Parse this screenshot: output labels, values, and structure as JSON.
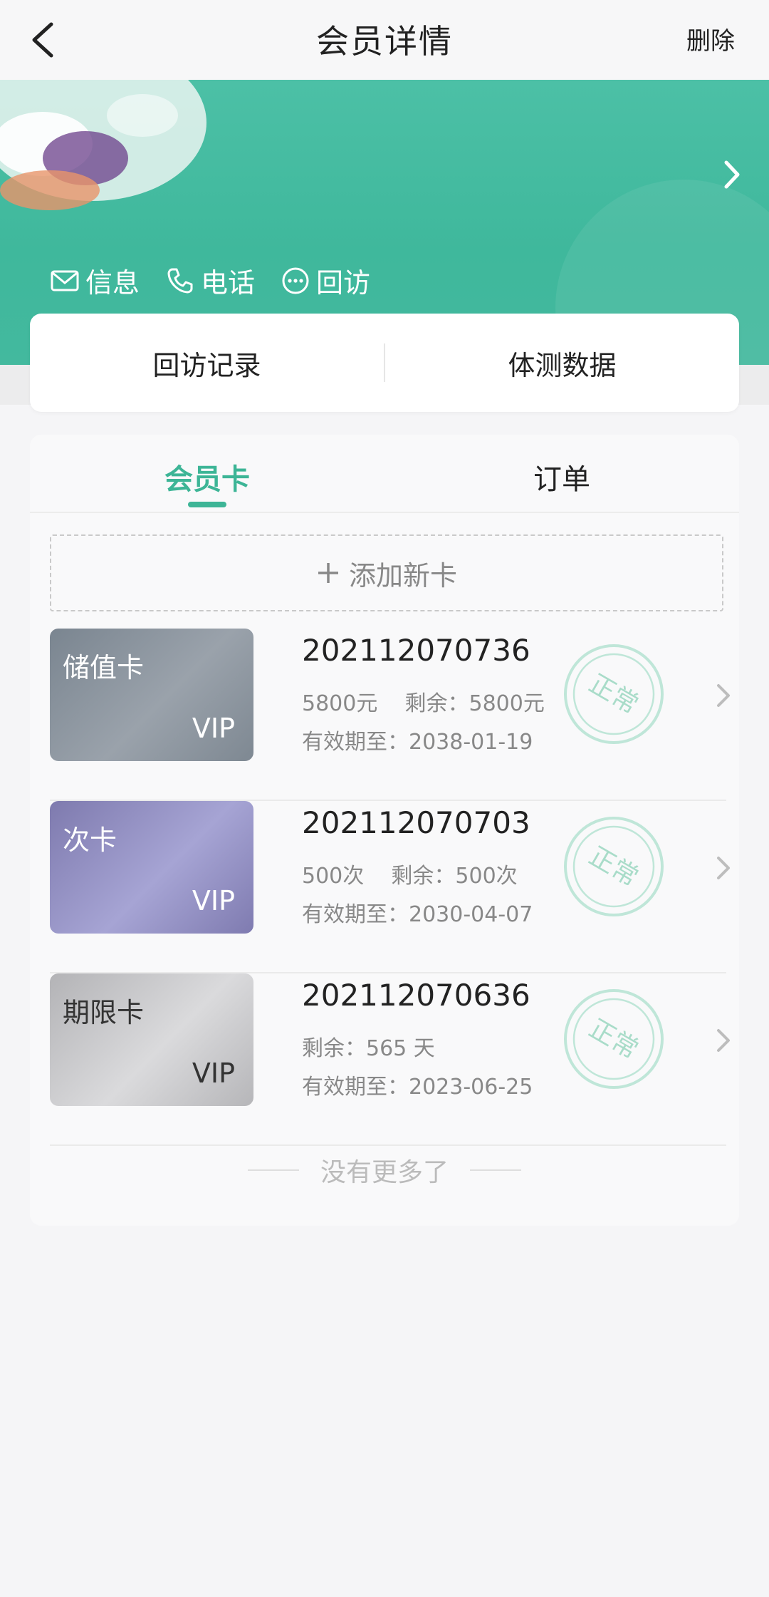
{
  "nav": {
    "title": "会员详情",
    "delete_label": "删除"
  },
  "header": {
    "actions": [
      {
        "label": "信息",
        "icon": "mail-icon"
      },
      {
        "label": "电话",
        "icon": "phone-icon"
      },
      {
        "label": "回访",
        "icon": "more-circle-icon"
      }
    ],
    "accent_color": "#43b99e"
  },
  "records": {
    "visit_label": "回访记录",
    "body_label": "体测数据"
  },
  "tabs": [
    {
      "label": "会员卡",
      "active": true
    },
    {
      "label": "订单",
      "active": false
    }
  ],
  "add_card_label": "添加新卡",
  "cards": [
    {
      "name": "储值卡",
      "badge": "VIP",
      "number": "202112070736",
      "info": "5800元    剩余：5800元",
      "expiry": "有效期至：2038-01-19",
      "status": "正常"
    },
    {
      "name": "次卡",
      "badge": "VIP",
      "number": "202112070703",
      "info": "500次    剩余：500次",
      "expiry": "有效期至：2030-04-07",
      "status": "正常"
    },
    {
      "name": "期限卡",
      "badge": "VIP",
      "number": "202112070636",
      "info": "剩余：565 天",
      "expiry": "有效期至：2023-06-25",
      "status": "正常"
    }
  ],
  "no_more_label": "没有更多了"
}
